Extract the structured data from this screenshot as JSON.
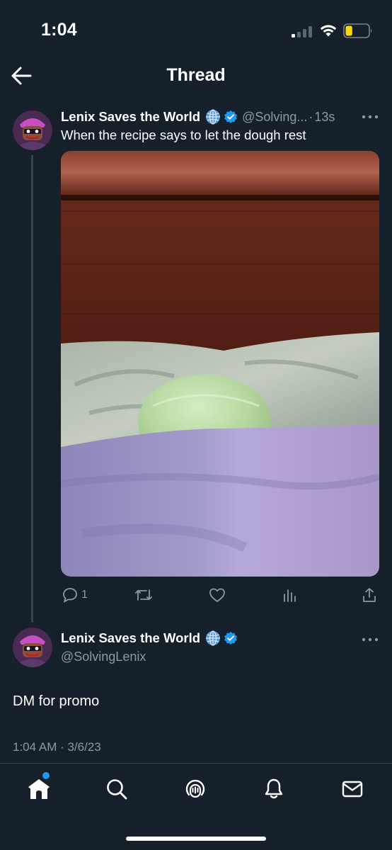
{
  "status_bar": {
    "time": "1:04",
    "battery_level": 0.3,
    "battery_color": "#ffd60a"
  },
  "header": {
    "title": "Thread",
    "back_icon": "arrow-left-icon"
  },
  "tweet_main": {
    "display_name": "Lenix Saves the World",
    "handle": "@Solving...",
    "separator": "·",
    "age": "13s",
    "text": "When the recipe says to let the dough rest",
    "media_icon": "photo-dough-in-bed",
    "actions": {
      "reply_count": "1",
      "retweet_icon": "retweet-icon",
      "like_icon": "heart-icon",
      "views_icon": "analytics-icon",
      "share_icon": "share-icon"
    }
  },
  "tweet_reply": {
    "display_name": "Lenix Saves the World",
    "handle": "@SolvingLenix",
    "text": "DM for promo",
    "timestamp": "1:04 AM · 3/6/23"
  },
  "tab_bar": {
    "items": [
      "home-icon",
      "search-icon",
      "spaces-icon",
      "notifications-icon",
      "messages-icon"
    ],
    "active": "home-icon",
    "accent": "#1d9bf0"
  },
  "colors": {
    "background": "#15202b",
    "secondary_text": "#8b98a5",
    "verified": "#1d9bf0"
  }
}
